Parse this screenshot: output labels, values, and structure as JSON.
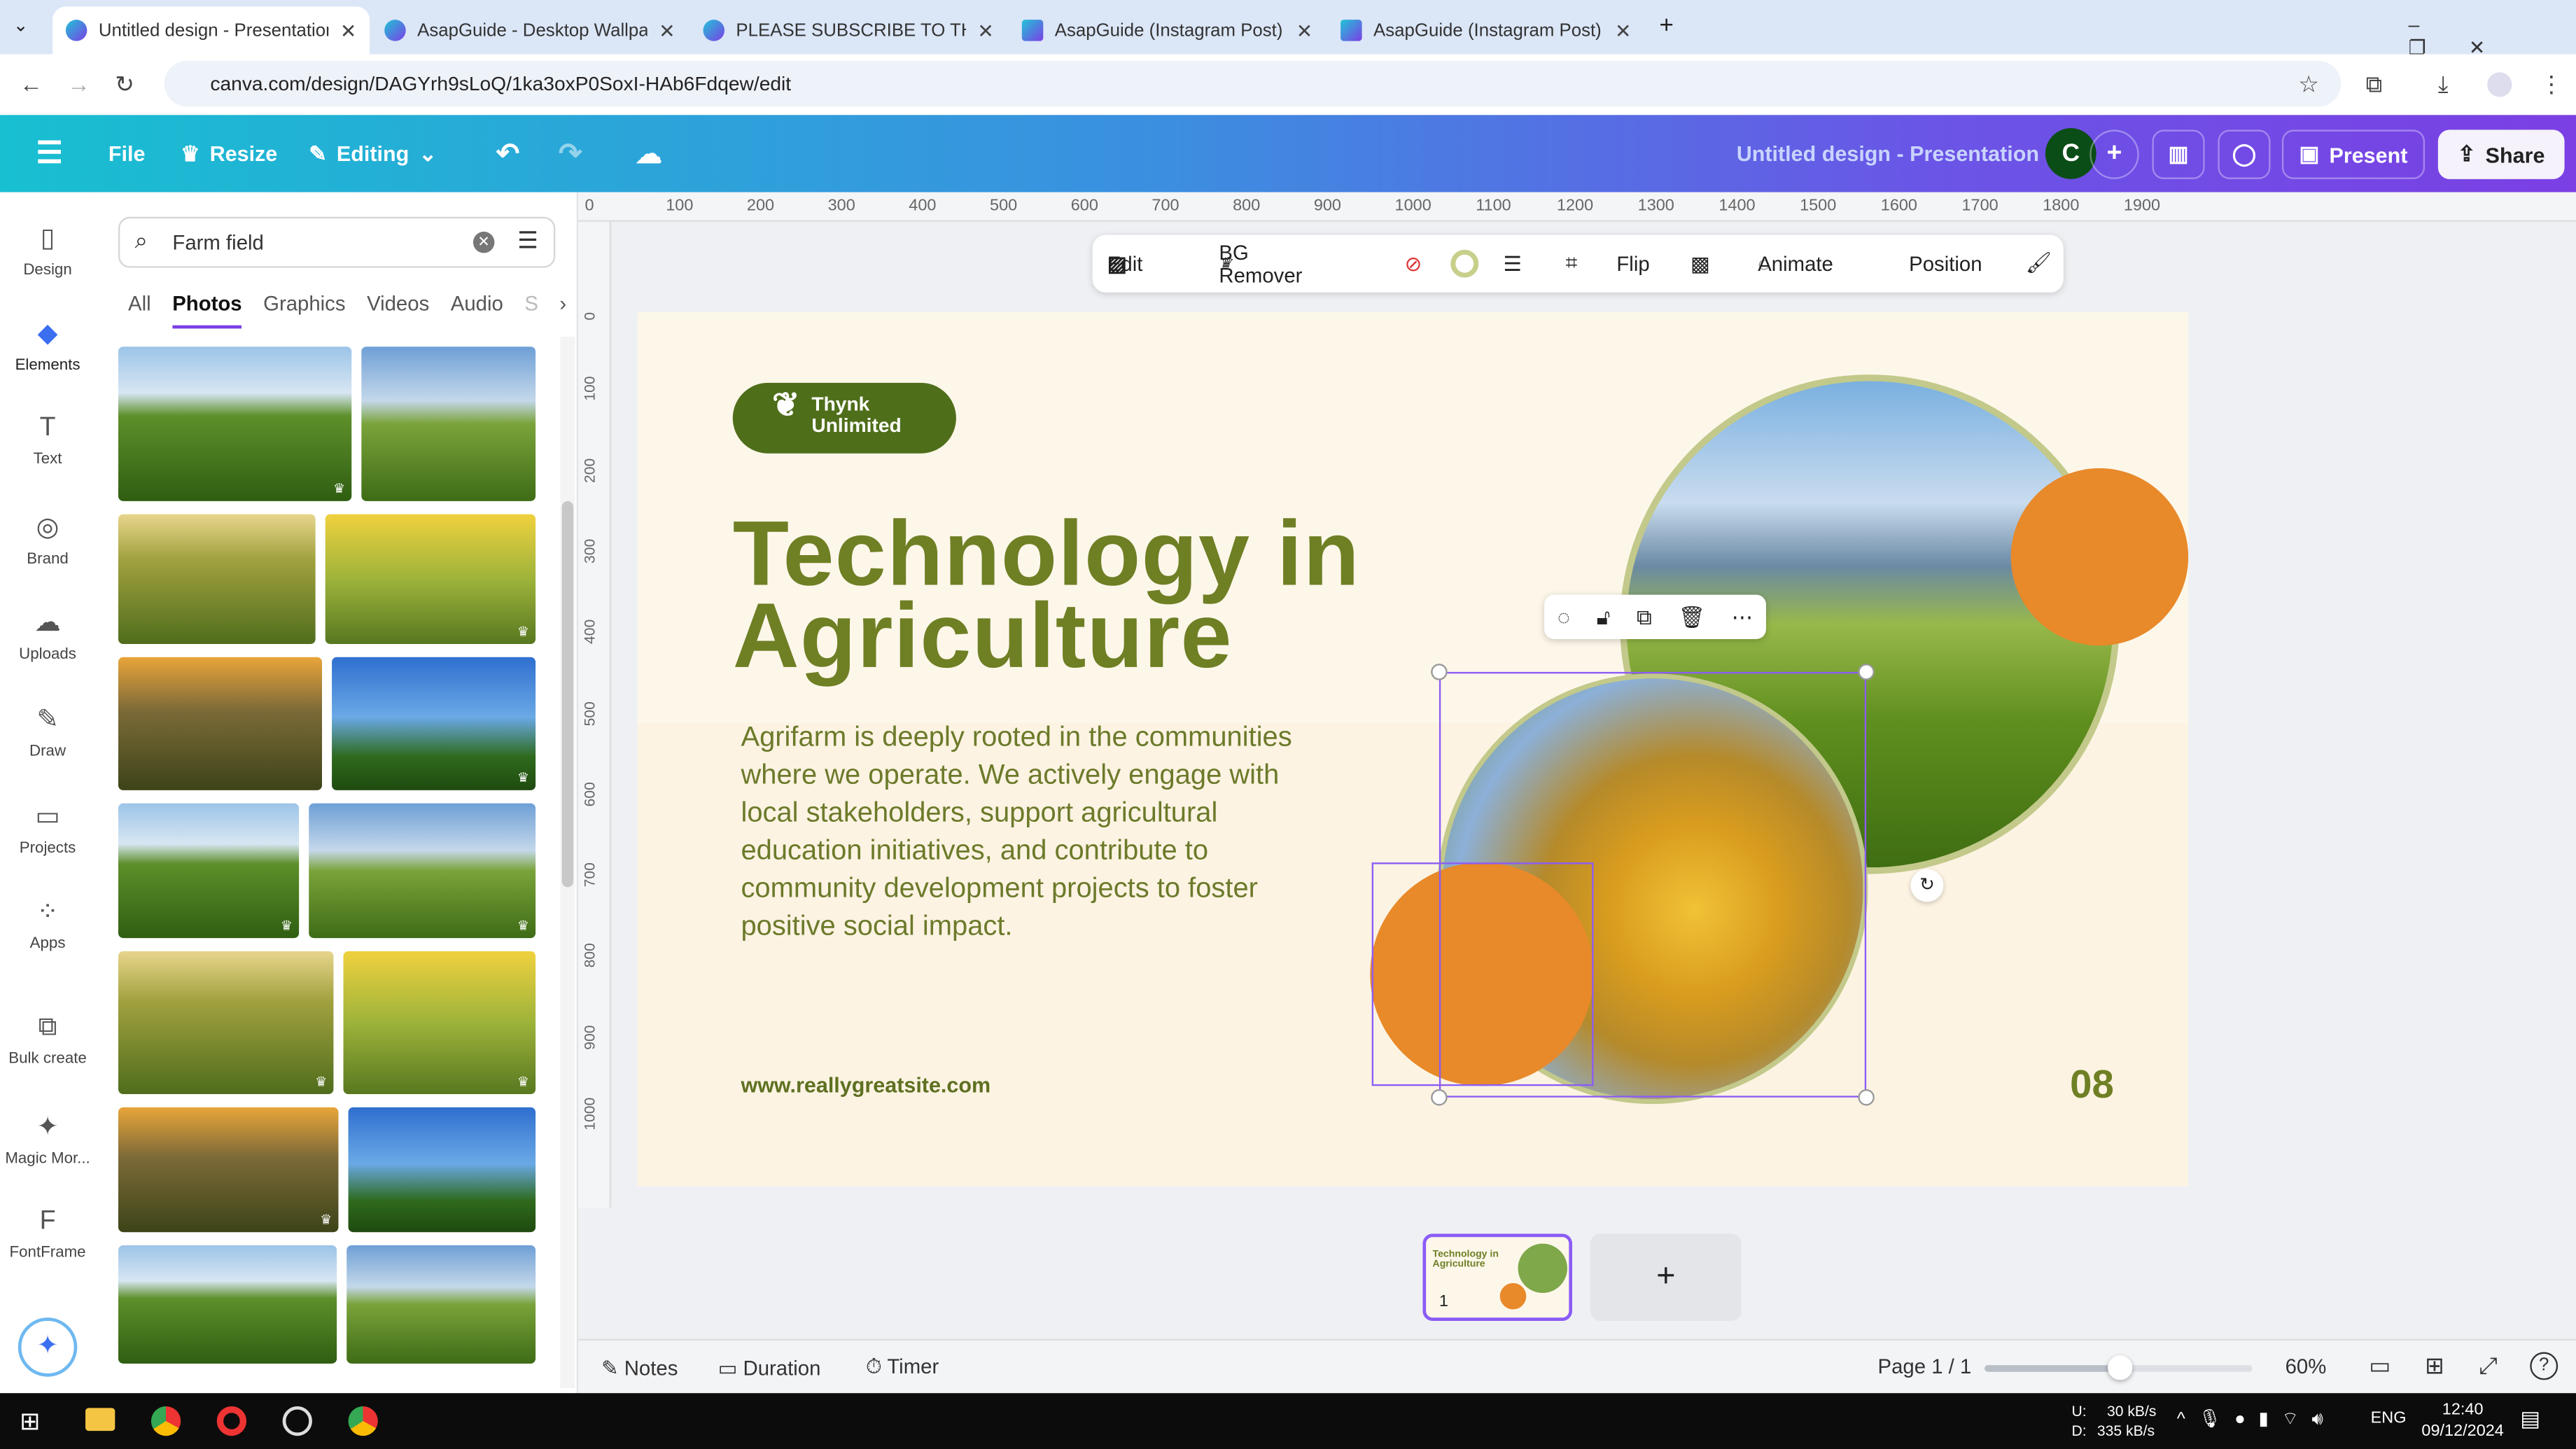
{
  "browser": {
    "tabs": [
      {
        "title": "Untitled design - Presentation",
        "active": true
      },
      {
        "title": "AsapGuide - Desktop Wallpape"
      },
      {
        "title": "PLEASE SUBSCRIBE TO THIS CH"
      },
      {
        "title": "AsapGuide (Instagram Post) - Y"
      },
      {
        "title": "AsapGuide (Instagram Post) (A"
      }
    ],
    "url": "canva.com/design/DAGYrh9sLoQ/1ka3oxP0SoxI-HAb6Fdqew/edit"
  },
  "header": {
    "file": "File",
    "resize": "Resize",
    "editing": "Editing",
    "doc_title": "Untitled design - Presentation",
    "avatar": "C",
    "present": "Present",
    "share": "Share"
  },
  "rail": [
    {
      "label": "Design",
      "icon": "▯"
    },
    {
      "label": "Elements",
      "icon": "◆"
    },
    {
      "label": "Text",
      "icon": "T"
    },
    {
      "label": "Brand",
      "icon": "◎"
    },
    {
      "label": "Uploads",
      "icon": "☁"
    },
    {
      "label": "Draw",
      "icon": "✎"
    },
    {
      "label": "Projects",
      "icon": "▭"
    },
    {
      "label": "Apps",
      "icon": "⁘"
    },
    {
      "label": "Bulk create",
      "icon": "⧉"
    },
    {
      "label": "Magic Mor...",
      "icon": "✦"
    },
    {
      "label": "FontFrame",
      "icon": "F"
    }
  ],
  "panel": {
    "search_value": "Farm field",
    "tabs": [
      "All",
      "Photos",
      "Graphics",
      "Videos",
      "Audio",
      "S"
    ]
  },
  "ruler": {
    "top": [
      "0",
      "100",
      "200",
      "300",
      "400",
      "500",
      "600",
      "700",
      "800",
      "900",
      "1000",
      "1100",
      "1200",
      "1300",
      "1400",
      "1500",
      "1600",
      "1700",
      "1800",
      "1900"
    ],
    "left": [
      "0",
      "100",
      "200",
      "300",
      "400",
      "500",
      "600",
      "700",
      "800",
      "900",
      "1000"
    ]
  },
  "toolbar": {
    "edit": "Edit",
    "bg_remover": "BG Remover",
    "flip": "Flip",
    "animate": "Animate",
    "position": "Position"
  },
  "slide": {
    "logo": "Thynk Unlimited",
    "title_line1": "Technology in",
    "title_line2": "Agriculture",
    "body": "Agrifarm is deeply rooted in the communities where we operate. We actively engage with local stakeholders, support agricultural education initiatives, and contribute to community development projects to foster positive social impact.",
    "url": "www.reallygreatsite.com",
    "page_num": "08",
    "colors": {
      "green": "#6f7f24",
      "orange": "#e8892a",
      "bg": "#fdf7ea"
    }
  },
  "pages": {
    "thumb_num": "1",
    "add": "+"
  },
  "bottom": {
    "notes": "Notes",
    "duration": "Duration",
    "timer": "Timer",
    "page": "Page 1 / 1",
    "zoom": "60%",
    "zoom_fraction": 0.5
  },
  "taskbar": {
    "up": "U:",
    "down": "D:",
    "up_rate": "30 kB/s",
    "down_rate": "335 kB/s",
    "lang": "ENG",
    "time": "12:40",
    "date": "09/12/2024"
  }
}
